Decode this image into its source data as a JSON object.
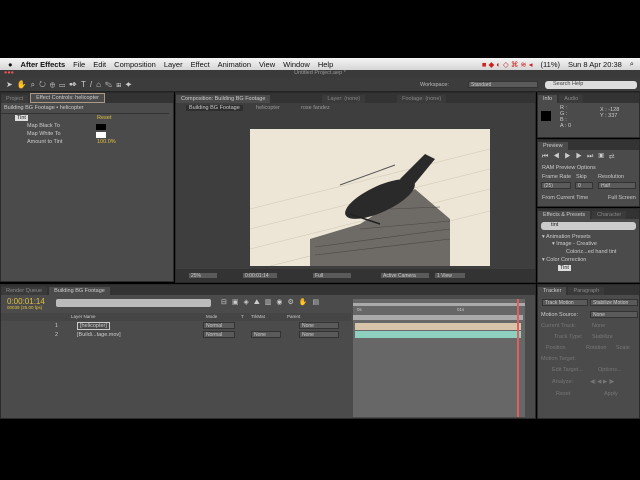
{
  "menubar": {
    "apple": "",
    "app": "After Effects",
    "items": [
      "File",
      "Edit",
      "Composition",
      "Layer",
      "Effect",
      "Animation",
      "View",
      "Window",
      "Help"
    ],
    "battery": "(11%)",
    "clock": "Sun 8 Apr  20:38"
  },
  "window": {
    "title": "Untitled Project.aep *"
  },
  "toolbar": {
    "workspace_label": "Workspace:",
    "workspace_value": "Standard",
    "search_placeholder": "Search Help"
  },
  "left_panel": {
    "tabs": [
      "Project",
      "Effect Controls: helicopter"
    ],
    "breadcrumb": "Building BG Footage • helicopter",
    "effect": "Tint",
    "reset": "Reset",
    "props": [
      {
        "label": "Map Black To",
        "color": "#000000"
      },
      {
        "label": "Map White To",
        "color": "#ffffff"
      },
      {
        "label": "Amount to Tint",
        "value": "100.0%"
      }
    ]
  },
  "comp": {
    "tab": "Composition: Building BG Footage",
    "layer_tab": "Layer: (none)",
    "footage_tab": "Footage: (none)",
    "crumbs": [
      "Building BG Footage",
      "helicopter",
      "rose fandez"
    ],
    "zoom": "25%",
    "timecode": "0:00:01:14",
    "resolution": "Full",
    "camera": "Active Camera",
    "views": "1 View"
  },
  "info": {
    "tabs": [
      "Info",
      "Audio"
    ],
    "rgb": [
      "R :",
      "G :",
      "B :",
      "A : 0"
    ],
    "xy": [
      "X : -128",
      "Y : 337"
    ]
  },
  "preview": {
    "tab": "Preview",
    "ram": "RAM Preview Options",
    "frame_rate_label": "Frame Rate",
    "skip_label": "Skip",
    "resolution_label": "Resolution",
    "frame_rate": "(25)",
    "skip": "0",
    "resolution": "Half",
    "from_current": "From Current Time",
    "full_screen": "Full Screen"
  },
  "effects": {
    "tabs": [
      "Effects & Presets",
      "Character"
    ],
    "search": "tint",
    "tree": [
      "▾ Animation Presets",
      "▾ Image - Creative",
      "Coloriz...ed hand tint",
      "▾ Color Correction",
      "Tint"
    ]
  },
  "timeline": {
    "tabs": [
      "Render Queue",
      "Building BG Footage"
    ],
    "timecode": "0:00:01:14",
    "fps": "00039 (25.00 fps)",
    "search_placeholder": "",
    "headers": [
      "Layer Name",
      "Mode",
      "T",
      "TrkMat",
      "Parent"
    ],
    "layers": [
      {
        "num": "1",
        "name": "[helicopter]",
        "mode": "Normal",
        "trkmat": "",
        "parent": "None",
        "color": "#d8c4a8"
      },
      {
        "num": "2",
        "name": "[Buildi...tage.mov]",
        "mode": "Normal",
        "trkmat": "None",
        "parent": "None",
        "color": "#8ed0c0"
      }
    ],
    "ruler": [
      "0s",
      "01s"
    ]
  },
  "tracker": {
    "tabs": [
      "Tracker",
      "Paragraph"
    ],
    "track_motion": "Track Motion",
    "stabilize": "Stabilize Motion",
    "motion_source_label": "Motion Source:",
    "motion_source": "None",
    "current_track_label": "Current Track:",
    "current_track": "None",
    "track_type_label": "Track Type:",
    "track_type": "Stabilize",
    "rows": [
      "Position",
      "Rotation",
      "Scale",
      "Motion Target:",
      "Edit Target...",
      "Options...",
      "Analyze:",
      "Reset",
      "Apply"
    ]
  }
}
